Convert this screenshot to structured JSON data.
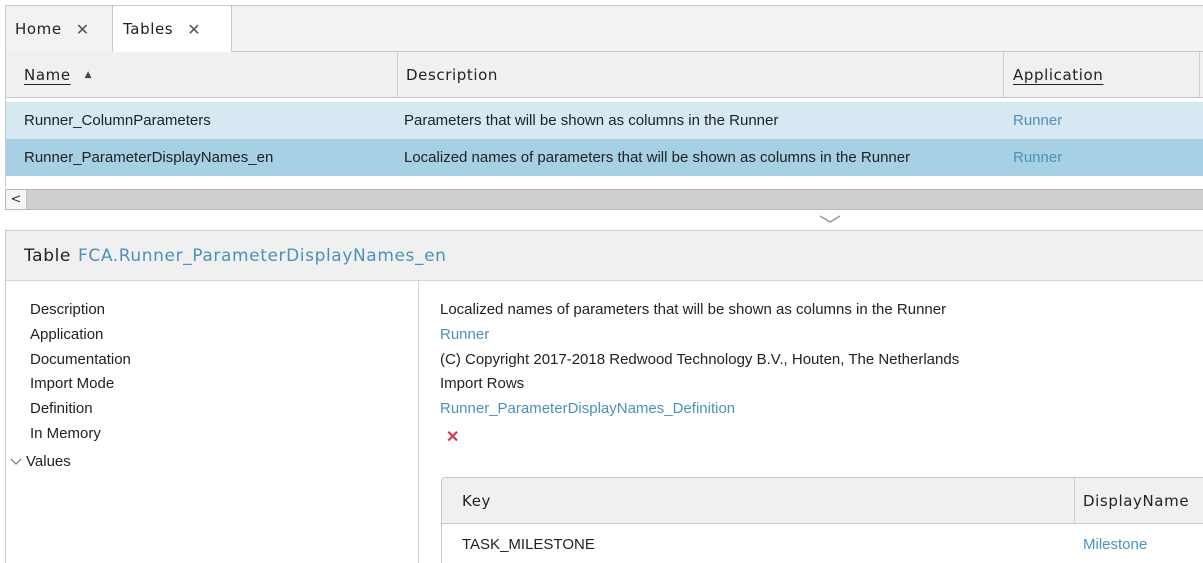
{
  "tabs": [
    {
      "label": "Home",
      "close": "✕"
    },
    {
      "label": "Tables",
      "close": "✕"
    }
  ],
  "grid": {
    "columns": [
      {
        "label": "Name",
        "sort": "▲"
      },
      {
        "label": "Description"
      },
      {
        "label": "Application"
      }
    ],
    "rows": [
      {
        "name": "Runner_ColumnParameters",
        "description": "Parameters that will be shown as columns in the Runner",
        "application": "Runner"
      },
      {
        "name": "Runner_ParameterDisplayNames_en",
        "description": "Localized names of parameters that will be shown as columns in the Runner",
        "application": "Runner"
      }
    ],
    "scroll_left": "<"
  },
  "splitter_icon": "chevron-down-icon",
  "detail": {
    "title_prefix": "Table",
    "title_name": "FCA.Runner_ParameterDisplayNames_en",
    "labels": [
      "Description",
      "Application",
      "Documentation",
      "Import Mode",
      "Definition",
      "In Memory",
      "Values"
    ],
    "values": {
      "description": "Localized names of parameters that will be shown as columns in the Runner",
      "application": "Runner",
      "documentation": "(C) Copyright 2017-2018 Redwood Technology B.V., Houten, The Netherlands",
      "import_mode": "Import Rows",
      "definition": "Runner_ParameterDisplayNames_Definition",
      "in_memory": "✕"
    },
    "values_table": {
      "columns": [
        "Key",
        "DisplayName"
      ],
      "rows": [
        {
          "key": "TASK_MILESTONE",
          "display_name": "Milestone"
        }
      ]
    }
  },
  "colors": {
    "link": "#4a93b8",
    "row_selected": "#a6d0e4",
    "row_hover": "#d6e8f1",
    "false_mark": "#d8354a"
  }
}
